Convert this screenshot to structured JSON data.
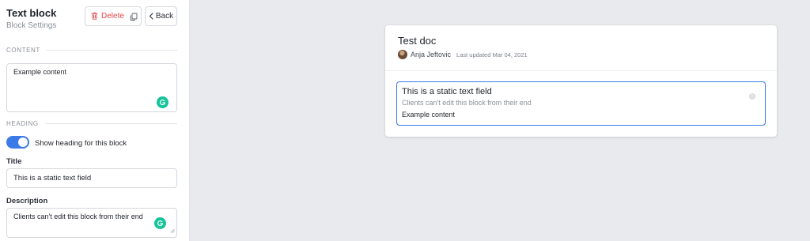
{
  "sidebar": {
    "title": "Text block",
    "subtitle": "Block Settings",
    "delete_label": "Delete",
    "back_label": "Back",
    "content_section": "CONTENT",
    "content_value": "Example content",
    "heading_section": "HEADING",
    "toggle_label": "Show heading for this block",
    "toggle_on": true,
    "title_label": "Title",
    "title_value": "This is a static text field",
    "description_label": "Description",
    "description_value": "Clients can't edit this block from their end"
  },
  "preview": {
    "doc_title": "Test doc",
    "author": "Anja Jeftovic",
    "last_updated": "Last updated Mar 04, 2021",
    "block": {
      "title": "This is a static text field",
      "description": "Clients can't edit this block from their end",
      "content": "Example content"
    }
  },
  "colors": {
    "accent": "#3b7be8",
    "danger": "#e54848",
    "grammar": "#15c39a",
    "canvas": "#e9eaee"
  },
  "icons": [
    "trash-icon",
    "copy-icon",
    "chevron-left-icon",
    "grammar-assistant-icon",
    "info-icon",
    "resize-grip-icon"
  ]
}
